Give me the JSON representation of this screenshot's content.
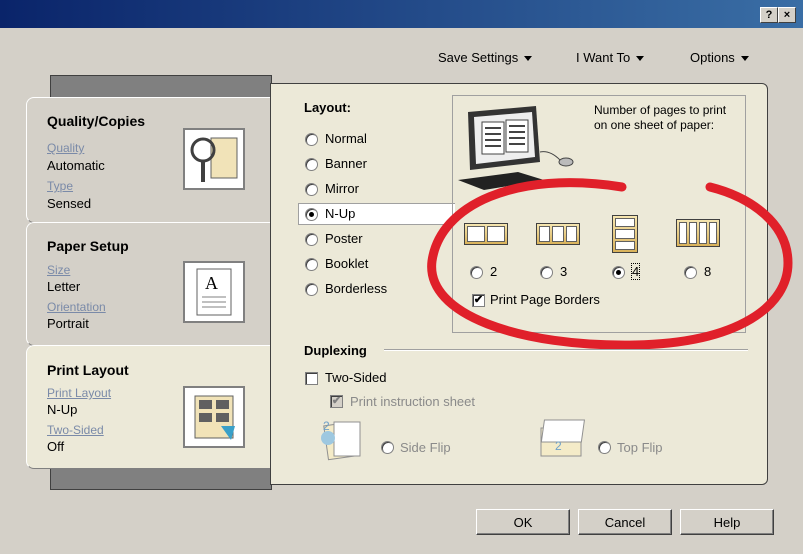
{
  "titlebar": {
    "help_label": "?",
    "close_label": "×"
  },
  "menubar": {
    "items": [
      {
        "label": "Save Settings"
      },
      {
        "label": "I Want To"
      },
      {
        "label": "Options"
      }
    ]
  },
  "tabs": [
    {
      "title": "Quality/Copies",
      "fields": [
        {
          "link": "Quality",
          "value": "Automatic"
        },
        {
          "link": "Type",
          "value": "Sensed"
        }
      ]
    },
    {
      "title": "Paper Setup",
      "fields": [
        {
          "link": "Size",
          "value": "Letter"
        },
        {
          "link": "Orientation",
          "value": "Portrait"
        }
      ]
    },
    {
      "title": "Print Layout",
      "fields": [
        {
          "link": "Print Layout",
          "value": "N-Up"
        },
        {
          "link": "Two-Sided",
          "value": "Off"
        }
      ]
    }
  ],
  "layout": {
    "heading": "Layout:",
    "options": [
      "Normal",
      "Banner",
      "Mirror",
      "N-Up",
      "Poster",
      "Booklet",
      "Borderless"
    ],
    "selected": "N-Up"
  },
  "nup": {
    "description": "Number of pages to print on one sheet of paper:",
    "options": [
      "2",
      "3",
      "4",
      "8"
    ],
    "selected": "4",
    "borders_label": "Print Page Borders",
    "borders_checked": true
  },
  "duplexing": {
    "heading": "Duplexing",
    "two_sided_label": "Two-Sided",
    "instruction_label": "Print instruction sheet",
    "side_flip_label": "Side Flip",
    "top_flip_label": "Top Flip"
  },
  "buttons": {
    "ok": "OK",
    "cancel": "Cancel",
    "help": "Help"
  },
  "colors": {
    "titlebar": "#0a246a",
    "annotation": "#e0202a",
    "dialog": "#d4d0c8"
  }
}
